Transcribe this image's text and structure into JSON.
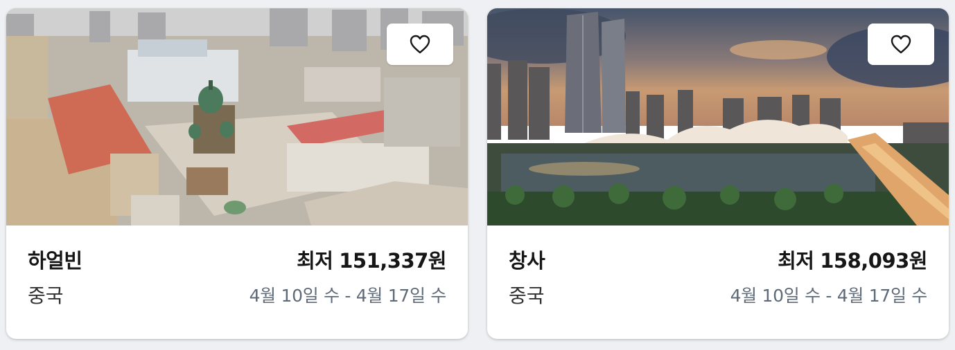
{
  "cards": [
    {
      "city": "하얼빈",
      "country": "중국",
      "price_prefix": "최저",
      "price": "151,337원",
      "dates": "4월 10일 수 - 4월 17일 수",
      "favorite_icon": "heart-outline-icon"
    },
    {
      "city": "창사",
      "country": "중국",
      "price_prefix": "최저",
      "price": "158,093원",
      "dates": "4월 10일 수 - 4월 17일 수",
      "favorite_icon": "heart-outline-icon"
    }
  ],
  "colors": {
    "card_bg": "#ffffff",
    "page_bg": "#eef0f3",
    "text_primary": "#161616",
    "text_secondary": "#5f6a78"
  }
}
